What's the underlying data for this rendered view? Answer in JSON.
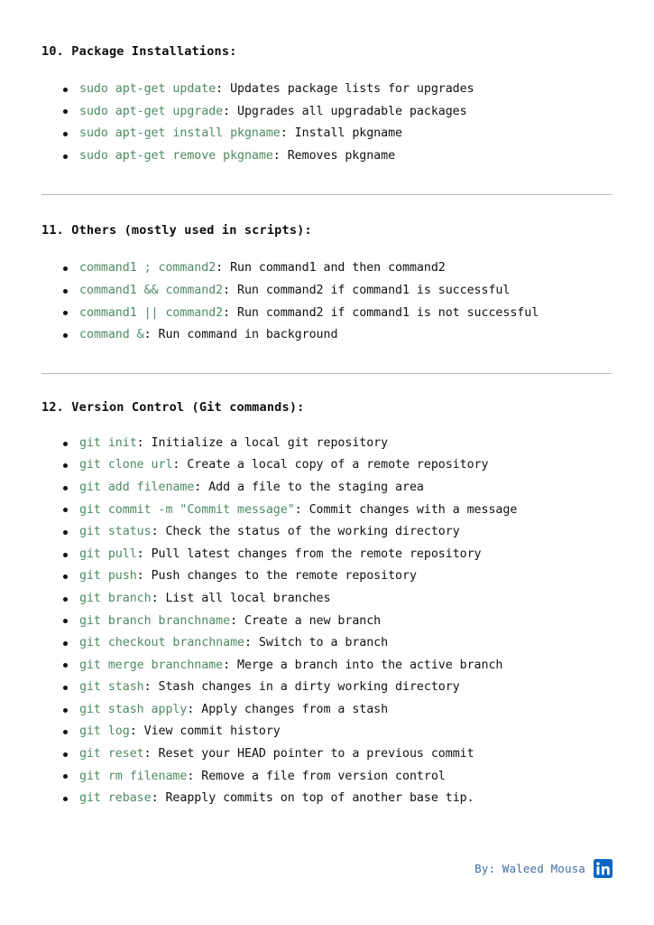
{
  "document": {
    "sections": [
      {
        "heading": "10. Package Installations:",
        "items": [
          {
            "code": "sudo apt-get update",
            "desc": ": Updates package lists for upgrades"
          },
          {
            "code": "sudo apt-get upgrade",
            "desc": ": Upgrades all upgradable packages"
          },
          {
            "code": "sudo apt-get install pkgname",
            "desc": ": Install pkgname"
          },
          {
            "code": "sudo apt-get remove pkgname",
            "desc": ": Removes pkgname"
          }
        ]
      },
      {
        "heading": "11. Others (mostly used in scripts):",
        "items": [
          {
            "code": "command1 ; command2",
            "desc": ": Run command1 and then command2"
          },
          {
            "code": "command1 && command2",
            "desc": ": Run command2 if command1 is successful"
          },
          {
            "code": "command1 || command2",
            "desc": ": Run command2 if command1 is not successful"
          },
          {
            "code": "command &",
            "desc": ": Run command in background"
          }
        ]
      },
      {
        "heading": "12. Version Control (Git commands):",
        "items": [
          {
            "code": "git init",
            "desc": ": Initialize a local git repository"
          },
          {
            "code": "git clone url",
            "desc": ": Create a local copy of a remote repository"
          },
          {
            "code": "git add filename",
            "desc": ": Add a file to the staging area"
          },
          {
            "code": "git commit -m \"Commit message\"",
            "desc": ": Commit changes with a message"
          },
          {
            "code": "git status",
            "desc": ": Check the status of the working directory"
          },
          {
            "code": "git pull",
            "desc": ": Pull latest changes from the remote repository"
          },
          {
            "code": "git push",
            "desc": ": Push changes to the remote repository"
          },
          {
            "code": "git branch",
            "desc": ": List all local branches"
          },
          {
            "code": "git branch branchname",
            "desc": ": Create a new branch"
          },
          {
            "code": "git checkout branchname",
            "desc": ": Switch to a branch"
          },
          {
            "code": "git merge branchname",
            "desc": ": Merge a branch into the active branch"
          },
          {
            "code": "git stash",
            "desc": ": Stash changes in a dirty working directory"
          },
          {
            "code": "git stash apply",
            "desc": ": Apply changes from a stash"
          },
          {
            "code": "git log",
            "desc": ": View commit history"
          },
          {
            "code": "git reset",
            "desc": ": Reset your HEAD pointer to a previous commit"
          },
          {
            "code": "git rm filename",
            "desc": ": Remove a file from version control"
          },
          {
            "code": "git rebase",
            "desc": ": Reapply commits on top of another base tip."
          }
        ]
      }
    ]
  },
  "footer": {
    "credit": "By: Waleed Mousa",
    "icon": "linkedin-icon"
  },
  "colors": {
    "code_green": "#4d8a61",
    "body_text": "#111111",
    "footer_blue": "#3f6fa6",
    "linkedin_blue": "#0a66c2",
    "divider_gray": "#b9b9b9",
    "background": "#ffffff"
  }
}
